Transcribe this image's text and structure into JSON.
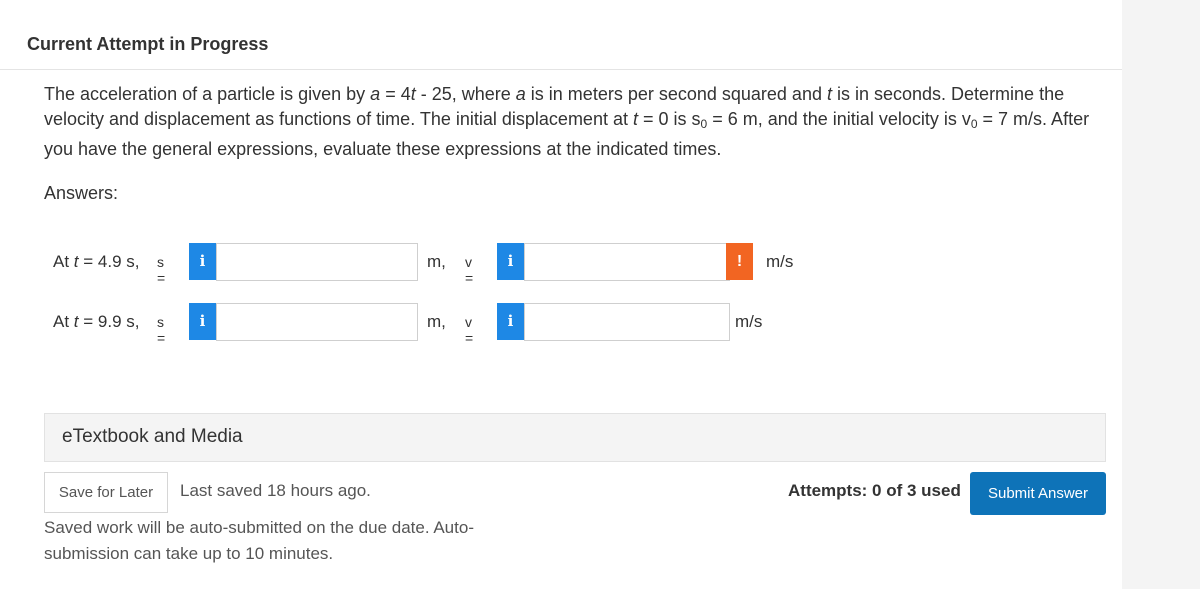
{
  "header": {
    "title": "Current Attempt in Progress"
  },
  "question": {
    "part1": "The acceleration of a particle is given by ",
    "a_var": "a",
    "eq1": " = 4",
    "t_var1": "t",
    "part2": " - 25, where ",
    "a_var2": "a",
    "part3": " is in meters per second squared and ",
    "t_var2": "t",
    "part4": " is in seconds. Determine the velocity and displacement as functions of time. The initial displacement at ",
    "t_var3": "t",
    "part5": " = 0 is s",
    "sub0a": "0",
    "part6": " = 6 m, and the initial velocity is v",
    "sub0b": "0",
    "part7": " = 7 m/s. After you have the general expressions, evaluate these expressions at the indicated times."
  },
  "answers_label": "Answers:",
  "rows": [
    {
      "at": "At ",
      "t": "t",
      "time": " = 4.9 s,",
      "s_label": "s =",
      "info_icon": "i",
      "s_value": "",
      "s_unit": "m,",
      "v_label": "v =",
      "v_value": "",
      "v_unit": "m/s",
      "warning": "!"
    },
    {
      "at": "At ",
      "t": "t",
      "time": " = 9.9 s,",
      "s_label": "s =",
      "info_icon": "i",
      "s_value": "",
      "s_unit": "m,",
      "v_label": "v =",
      "v_value": "",
      "v_unit": "m/s"
    }
  ],
  "etextbook": {
    "label": "eTextbook and Media"
  },
  "footer": {
    "save_label": "Save for Later",
    "last_saved": "Last saved 18 hours ago.",
    "auto_submit": "Saved work will be auto-submitted on the due date. Auto-submission can take up to 10 minutes.",
    "attempts": "Attempts: 0 of 3 used",
    "submit_label": "Submit Answer"
  },
  "colors": {
    "info": "#1e88e5",
    "warning": "#f26522",
    "submit": "#0e73b8"
  }
}
